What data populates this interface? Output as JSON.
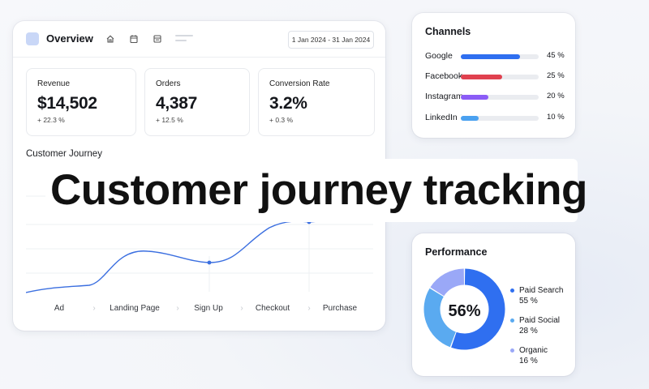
{
  "app": {
    "title": "Overview",
    "date_range": "1 Jan 2024 - 31 Jan 2024",
    "toolbar_icons": [
      "home-icon",
      "calendar-icon",
      "document-icon"
    ]
  },
  "stats": [
    {
      "label": "Revenue",
      "value": "$14,502",
      "change": "+ 22.3 %"
    },
    {
      "label": "Orders",
      "value": "4,387",
      "change": "+ 12.5 %"
    },
    {
      "label": "Conversion Rate",
      "value": "3.2%",
      "change": "+ 0.3 %"
    }
  ],
  "journey": {
    "title": "Customer Journey",
    "steps": [
      "Ad",
      "Landing Page",
      "Sign Up",
      "Checkout",
      "Purchase"
    ],
    "accent": "#3b6fe0"
  },
  "headline": "Customer journey tracking",
  "channels": {
    "title": "Channels",
    "items": [
      {
        "name": "Google",
        "percent": 45,
        "label": "45 %",
        "color": "#2f6ff0",
        "fill_fraction": 0.76
      },
      {
        "name": "Facebook",
        "percent": 25,
        "label": "25 %",
        "color": "#e0414f",
        "fill_fraction": 0.53
      },
      {
        "name": "Instagram",
        "percent": 20,
        "label": "20 %",
        "color": "#8b5cf6",
        "fill_fraction": 0.35
      },
      {
        "name": "LinkedIn",
        "percent": 10,
        "label": "10 %",
        "color": "#4aa1f0",
        "fill_fraction": 0.23
      }
    ]
  },
  "performance": {
    "title": "Performance",
    "center_value": "56%",
    "segments": [
      {
        "name": "Paid Search",
        "label": "55 %",
        "value": 55,
        "color": "#2f6ff0"
      },
      {
        "name": "Paid Social",
        "label": "28 %",
        "value": 28,
        "color": "#5aaaf0"
      },
      {
        "name": "Organic",
        "label": "16 %",
        "value": 16,
        "color": "#9aa8f7"
      }
    ]
  }
}
